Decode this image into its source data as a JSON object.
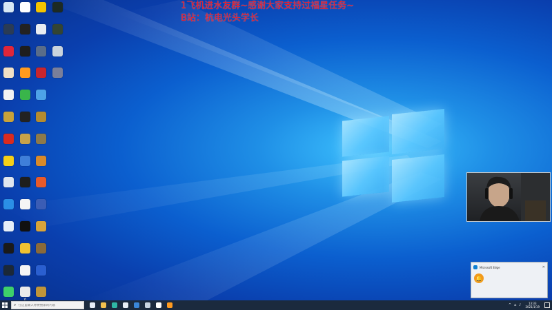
{
  "overlay": {
    "line1": "1飞机进水友群~感谢大家支持过福星任务~",
    "line2": "B站：杭电光头学长"
  },
  "desktop_icons": [
    {
      "label": "",
      "color": "#d8e8f5"
    },
    {
      "label": "",
      "color": "#ffffff"
    },
    {
      "label": "",
      "color": "#f4c400"
    },
    {
      "label": "",
      "color": "#1d2a23"
    },
    {
      "label": "",
      "color": "#2a3b55"
    },
    {
      "label": "",
      "color": "#222222"
    },
    {
      "label": "",
      "color": "#e9edf2"
    },
    {
      "label": "",
      "color": "#334433"
    },
    {
      "label": "",
      "color": "#e0263a"
    },
    {
      "label": "",
      "color": "#1e1e1e"
    },
    {
      "label": "",
      "color": "#5a6d8a"
    },
    {
      "label": "",
      "color": "#c9d3dd"
    },
    {
      "label": "",
      "color": "#f1e0c5"
    },
    {
      "label": "",
      "color": "#ff9a1f"
    },
    {
      "label": "",
      "color": "#c8252d"
    },
    {
      "label": "",
      "color": "#7a7f9a"
    },
    {
      "label": "",
      "color": "#f2f2f2"
    },
    {
      "label": "",
      "color": "#39b54a"
    },
    {
      "label": "",
      "color": "#4da3e8"
    },
    {
      "label": "",
      "color": "#00000000"
    },
    {
      "label": "",
      "color": "#c9a23a"
    },
    {
      "label": "",
      "color": "#222222"
    },
    {
      "label": "",
      "color": "#b58b2e"
    },
    {
      "label": "",
      "color": "#00000000"
    },
    {
      "label": "",
      "color": "#d92b1f"
    },
    {
      "label": "",
      "color": "#c7a24a"
    },
    {
      "label": "",
      "color": "#8d7a4a"
    },
    {
      "label": "",
      "color": "#00000000"
    },
    {
      "label": "",
      "color": "#f4d018"
    },
    {
      "label": "",
      "color": "#3f7fd9"
    },
    {
      "label": "",
      "color": "#d98a2a"
    },
    {
      "label": "",
      "color": "#00000000"
    },
    {
      "label": "",
      "color": "#dfe6ee"
    },
    {
      "label": "",
      "color": "#1e1e1e"
    },
    {
      "label": "",
      "color": "#e85a2a"
    },
    {
      "label": "",
      "color": "#00000000"
    },
    {
      "label": "",
      "color": "#2b8fe6"
    },
    {
      "label": "",
      "color": "#f5f5f5"
    },
    {
      "label": "",
      "color": "#3b5db5"
    },
    {
      "label": "",
      "color": "#00000000"
    },
    {
      "label": "",
      "color": "#e6eef8"
    },
    {
      "label": "",
      "color": "#111111"
    },
    {
      "label": "",
      "color": "#d9a43a"
    },
    {
      "label": "",
      "color": "#00000000"
    },
    {
      "label": "",
      "color": "#1a1a1a"
    },
    {
      "label": "",
      "color": "#f1c232"
    },
    {
      "label": "",
      "color": "#8a6a3a"
    },
    {
      "label": "",
      "color": "#00000000"
    },
    {
      "label": "",
      "color": "#1b2838"
    },
    {
      "label": "",
      "color": "#f5f5f5"
    },
    {
      "label": "",
      "color": "#2a5fd0"
    },
    {
      "label": "",
      "color": "#00000000"
    },
    {
      "label": "",
      "color": "#3ecf6b"
    },
    {
      "label": "YI",
      "color": "#eaeaea"
    },
    {
      "label": "",
      "color": "#c0953a"
    },
    {
      "label": "",
      "color": "#00000000"
    }
  ],
  "notification": {
    "app": "Microsoft Edge",
    "title": "",
    "line1": "",
    "line2": "",
    "close": "✕"
  },
  "taskbar": {
    "search_placeholder": "在这里输入你要搜索的内容",
    "apps": [
      {
        "name": "task-view",
        "color": "#e8eef6"
      },
      {
        "name": "file-explorer",
        "color": "#f2c14e"
      },
      {
        "name": "edge",
        "color": "#2fb8a4"
      },
      {
        "name": "chrome",
        "color": "#e8eef6"
      },
      {
        "name": "app-5",
        "color": "#3a86d8"
      },
      {
        "name": "steam",
        "color": "#c9d5e2"
      },
      {
        "name": "app-7",
        "color": "#ffffff"
      },
      {
        "name": "app-8",
        "color": "#ff9a1f"
      }
    ],
    "clock_time": "13:33",
    "clock_date": "2021/1/19"
  }
}
